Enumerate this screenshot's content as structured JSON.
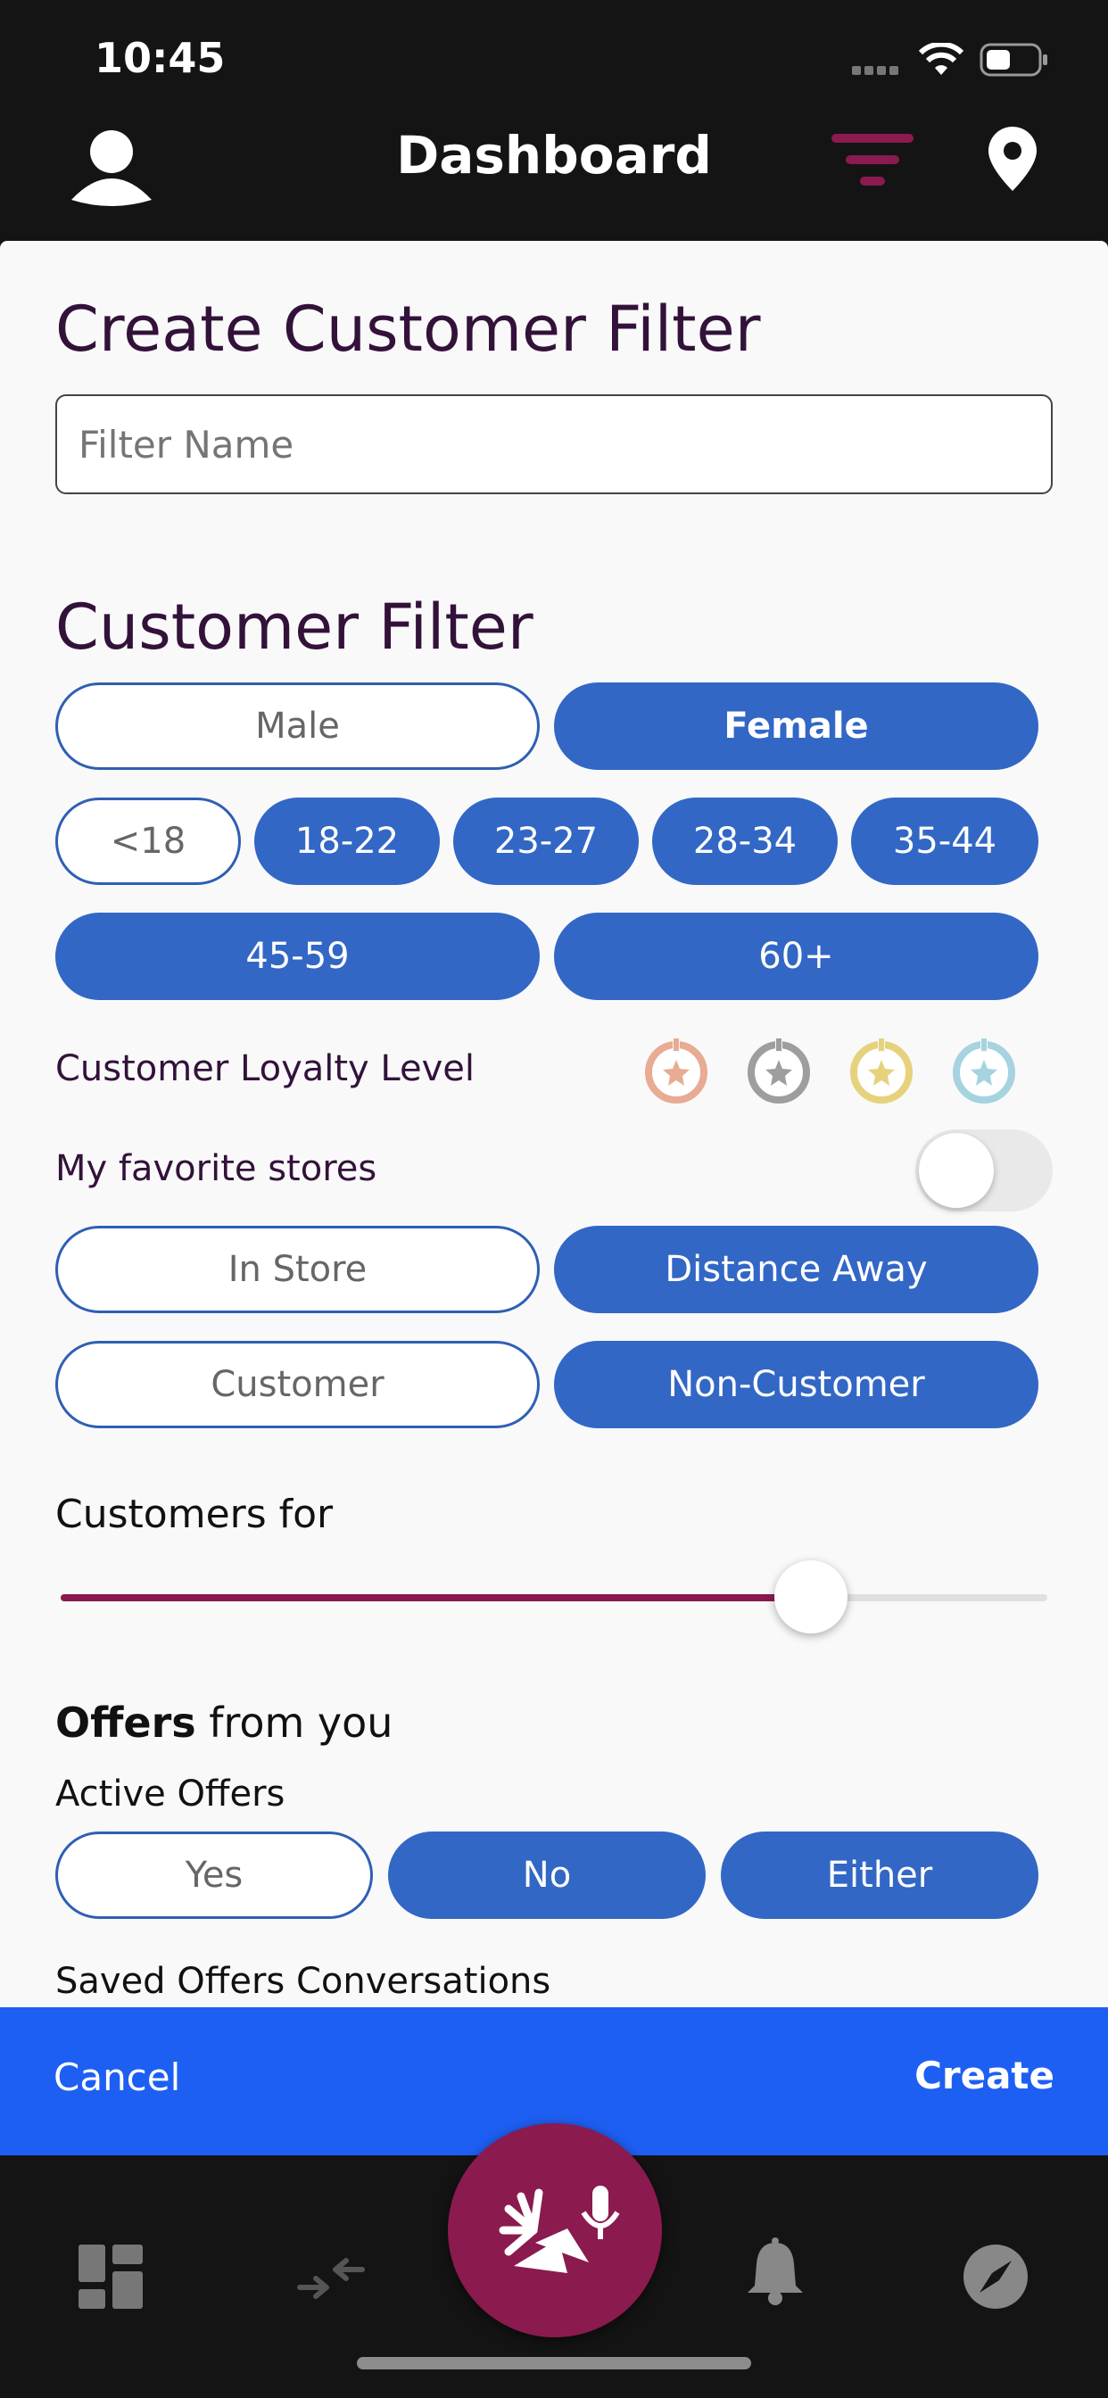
{
  "status_bar": {
    "time": "10:45"
  },
  "header": {
    "title": "Dashboard"
  },
  "form": {
    "title": "Create Customer Filter",
    "filter_name_placeholder": "Filter Name",
    "section_title": "Customer Filter",
    "gender": [
      {
        "label": "Male",
        "selected": false
      },
      {
        "label": "Female",
        "selected": true
      }
    ],
    "age_groups": [
      {
        "label": "<18",
        "selected": false
      },
      {
        "label": "18-22",
        "selected": true
      },
      {
        "label": "23-27",
        "selected": true
      },
      {
        "label": "28-34",
        "selected": true
      },
      {
        "label": "35-44",
        "selected": true
      },
      {
        "label": "45-59",
        "selected": true
      },
      {
        "label": "60+",
        "selected": true
      }
    ],
    "loyalty_label": "Customer Loyalty Level",
    "loyalty_levels": [
      {
        "name": "bronze",
        "color": "#e8ab93"
      },
      {
        "name": "silver",
        "color": "#9e9e9e"
      },
      {
        "name": "gold",
        "color": "#e6d27c"
      },
      {
        "name": "platinum",
        "color": "#a6d3e0"
      }
    ],
    "favorites_label": "My favorite stores",
    "favorites_on": false,
    "location": [
      {
        "label": "In Store",
        "selected": false
      },
      {
        "label": "Distance Away",
        "selected": true
      }
    ],
    "customer_type": [
      {
        "label": "Customer",
        "selected": false
      },
      {
        "label": "Non-Customer",
        "selected": true
      }
    ],
    "customers_for_label": "Customers for",
    "customers_for_value": 0.76,
    "offers_bold": "Offers",
    "offers_rest": " from you",
    "active_offers_label": "Active Offers",
    "active_offers": [
      {
        "label": "Yes",
        "selected": false
      },
      {
        "label": "No",
        "selected": true
      },
      {
        "label": "Either",
        "selected": true
      }
    ],
    "saved_offers_label": "Saved Offers Conversations"
  },
  "actions": {
    "cancel": "Cancel",
    "create": "Create"
  },
  "colors": {
    "accent_blue": "#3267c5",
    "brand": "#8b1a4f",
    "action_bar": "#1e5ff3"
  },
  "tabbar": {
    "items": [
      "dashboard-icon",
      "transfer-icon",
      "mic-fab",
      "bell-icon",
      "compass-icon"
    ]
  }
}
